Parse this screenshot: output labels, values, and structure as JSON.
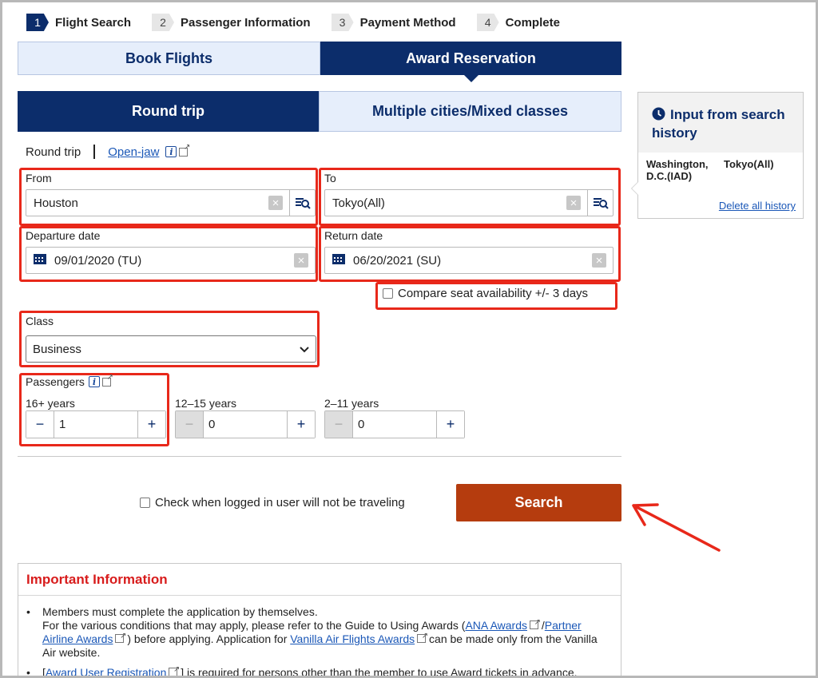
{
  "steps": [
    {
      "num": "1",
      "label": "Flight Search"
    },
    {
      "num": "2",
      "label": "Passenger Information"
    },
    {
      "num": "3",
      "label": "Payment Method"
    },
    {
      "num": "4",
      "label": "Complete"
    }
  ],
  "top_tabs": {
    "book": "Book Flights",
    "award": "Award Reservation"
  },
  "trip_tabs": {
    "round": "Round trip",
    "multi": "Multiple cities/Mixed classes"
  },
  "subtrip": {
    "round": "Round trip",
    "openjaw": "Open-jaw"
  },
  "from": {
    "label": "From",
    "value": "Houston"
  },
  "to": {
    "label": "To",
    "value": "Tokyo(All)"
  },
  "departure": {
    "label": "Departure date",
    "value": "09/01/2020 (TU)"
  },
  "return": {
    "label": "Return date",
    "value": "06/20/2021 (SU)"
  },
  "compare_label": "Compare seat availability +/- 3 days",
  "class": {
    "label": "Class",
    "value": "Business"
  },
  "passengers": {
    "label": "Passengers",
    "groups": [
      {
        "label": "16+ years",
        "value": "1"
      },
      {
        "label": "12–15 years",
        "value": "0"
      },
      {
        "label": "2–11 years",
        "value": "0"
      }
    ]
  },
  "not_traveling_label": "Check when logged in user will not be traveling",
  "search_label": "Search",
  "important": {
    "title": "Important Information",
    "b1_l1": "Members must complete the application by themselves.",
    "b1_l2a": "For the various conditions that may apply, please refer to the Guide to Using Awards (",
    "ana_awards": "ANA Awards",
    "slash": "/",
    "partner_awards": "Partner Airline Awards",
    "b1_l2b": ") before applying. Application for",
    "vanilla": "Vanilla Air Flights Awards",
    "b1_l2c": "can be made only from the Vanilla Air website.",
    "b2_pre": "[",
    "award_user": "Award User Registration",
    "b2_post": "] is required for persons other than the member to use Award tickets in advance."
  },
  "history": {
    "title": "Input from search history",
    "from": "Washington, D.C.(IAD)",
    "to": "Tokyo(All)",
    "delete": "Delete all history"
  },
  "colors": {
    "navy": "#0c2d6b",
    "annotation_red": "#e8281a",
    "search_button": "#b53c0e",
    "important_red": "#d81c1c"
  }
}
